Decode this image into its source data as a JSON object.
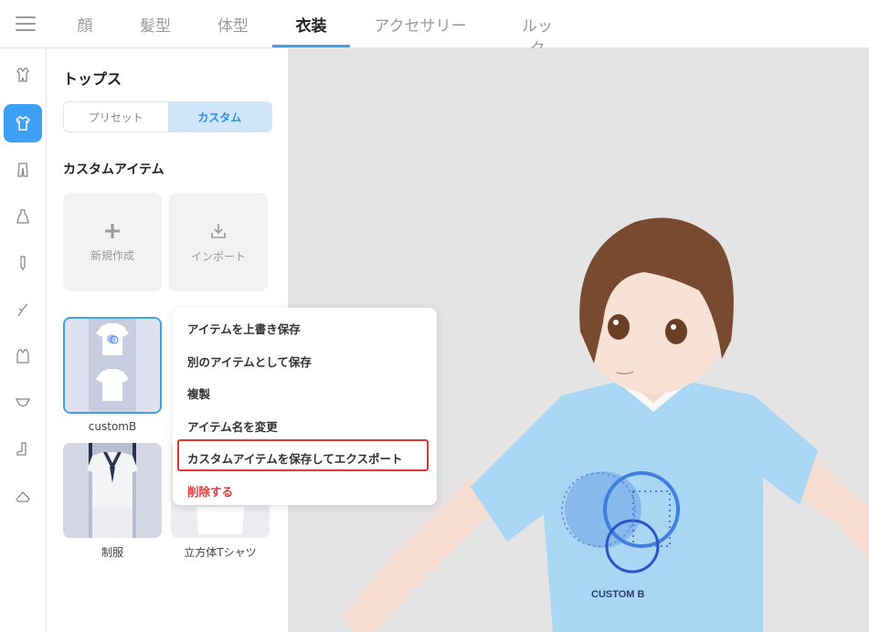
{
  "tabs": [
    {
      "label": "顔",
      "active": false
    },
    {
      "label": "髪型",
      "active": false
    },
    {
      "label": "体型",
      "active": false
    },
    {
      "label": "衣装",
      "active": true
    },
    {
      "label": "アクセサリー",
      "active": false
    },
    {
      "label": "ルック",
      "active": false
    }
  ],
  "sidebar_icons": [
    "overall-icon",
    "tops-icon",
    "bottoms-icon",
    "onepiece-icon",
    "socks-icon",
    "gloves-icon",
    "outer-icon",
    "underwear-icon",
    "boots-icon",
    "shoes-icon"
  ],
  "panel": {
    "title": "トップス",
    "segments": {
      "preset": "プリセット",
      "custom": "カスタム"
    },
    "section_title": "カスタムアイテム",
    "new_label": "新規作成",
    "import_label": "インポート",
    "items": [
      {
        "caption": "customB"
      },
      {
        "caption": "制服"
      },
      {
        "caption": "立方体Tシャツ"
      }
    ]
  },
  "context_menu": {
    "items": [
      "アイテムを上書き保存",
      "別のアイテムとして保存",
      "複製",
      "アイテム名を変更",
      "カスタムアイテムを保存してエクスポート"
    ],
    "delete_label": "削除する"
  },
  "shirt_print": "CUSTOM B",
  "colors": {
    "accent": "#3ea0f5",
    "danger": "#e23b3b",
    "shirt": "#a9d6f2"
  }
}
